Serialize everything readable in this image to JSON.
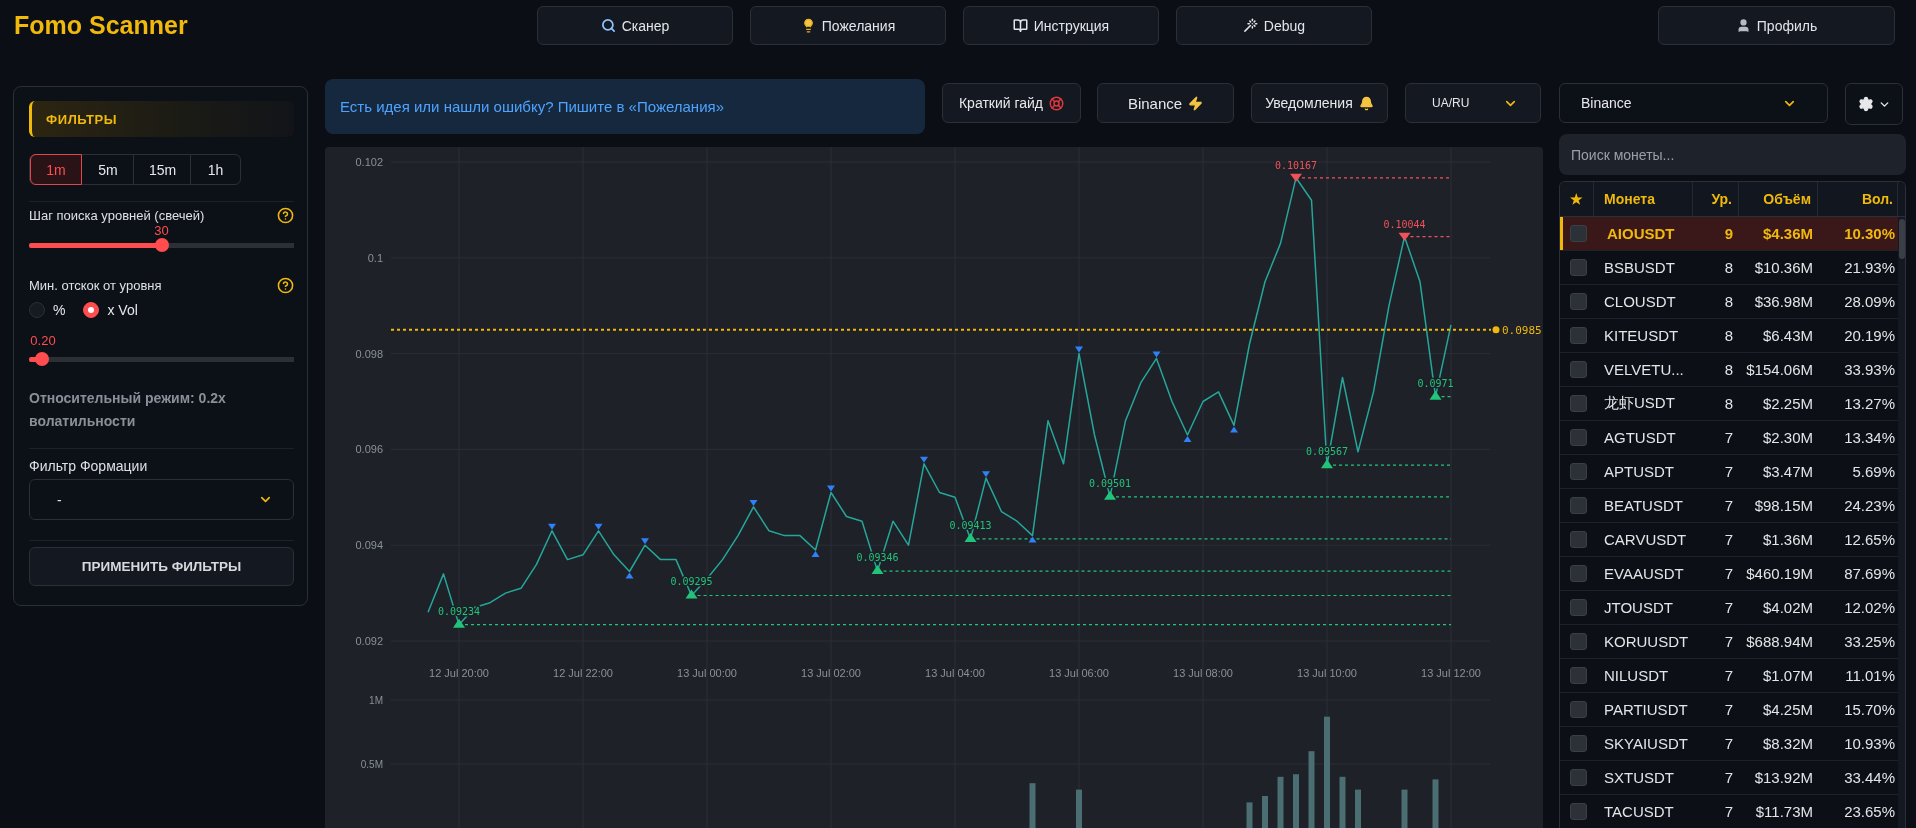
{
  "header": {
    "logo": "Fomo Scanner",
    "nav": [
      "Сканер",
      "Пожелания",
      "Инструкция",
      "Debug"
    ],
    "profile": "Профиль"
  },
  "filters": {
    "title": "ФИЛЬТРЫ",
    "timeframes": [
      {
        "label": "1m",
        "selected": true
      },
      {
        "label": "5m",
        "selected": false
      },
      {
        "label": "15m",
        "selected": false
      },
      {
        "label": "1h",
        "selected": false
      }
    ],
    "level_step": {
      "label": "Шаг поиска уровней (свечей)",
      "reading": "30",
      "level": 0.5
    },
    "min_bounce": {
      "label": "Мин. отскок от уровня",
      "modes": [
        {
          "label": "%",
          "selected": false
        },
        {
          "label": "x Vol",
          "selected": true
        }
      ],
      "reading": "0.20",
      "level": 0.05
    },
    "mode_note": "Относительный режим: 0.2x волатильности",
    "formation": {
      "label": "Фильтр Формации",
      "value": "-"
    },
    "apply_button": "ПРИМЕНИТЬ ФИЛЬТРЫ"
  },
  "banner": "Есть идея или нашли ошибку? Пишите в «Пожелания»",
  "toolbar": {
    "buttons": [
      "Краткий гайд",
      "Binance",
      "Уведомления"
    ],
    "language": "UA/RU"
  },
  "exchange_select": {
    "value": "Binance"
  },
  "chart": {
    "chart_data": {
      "type": "line",
      "grid": true,
      "categories": [
        null,
        null,
        "12 Jul 20:00",
        null,
        null,
        null,
        null,
        null,
        null,
        null,
        "12 Jul 22:00",
        null,
        null,
        null,
        null,
        null,
        null,
        null,
        "13 Jul 00:00",
        null,
        null,
        null,
        null,
        null,
        null,
        null,
        "13 Jul 02:00",
        null,
        null,
        null,
        null,
        null,
        null,
        null,
        "13 Jul 04:00",
        null,
        null,
        null,
        null,
        null,
        null,
        null,
        "13 Jul 06:00",
        null,
        null,
        null,
        null,
        null,
        null,
        null,
        "13 Jul 08:00",
        null,
        null,
        null,
        null,
        null,
        null,
        null,
        "13 Jul 10:00",
        null,
        null,
        null,
        null,
        null,
        null,
        null,
        "13 Jul 12:00"
      ],
      "series": [
        {
          "color": "#26a69a",
          "values": [
            0.0926,
            0.0934,
            0.09234,
            0.0927,
            0.0928,
            0.093,
            0.0931,
            0.0936,
            0.0943,
            0.0937,
            0.0938,
            0.0943,
            0.0938,
            0.09345,
            0.094,
            0.0937,
            0.0937,
            0.09295,
            0.0933,
            0.0937,
            0.0942,
            0.0948,
            0.0943,
            0.0942,
            0.0942,
            0.0939,
            0.0951,
            0.0946,
            0.0945,
            0.09346,
            0.0945,
            0.094,
            0.0957,
            0.0951,
            0.095,
            0.09413,
            0.0954,
            0.0947,
            0.0945,
            0.0942,
            0.0966,
            0.0957,
            0.098,
            0.0963,
            0.09501,
            0.0966,
            0.0974,
            0.0979,
            0.097,
            0.0963,
            0.097,
            0.0972,
            0.0965,
            0.0982,
            0.0995,
            0.1003,
            0.10167,
            0.1012,
            0.09567,
            0.0975,
            0.09595,
            0.0972,
            0.099,
            0.10044,
            0.0995,
            0.0971,
            0.0986
          ]
        }
      ],
      "ylim": [
        0.092,
        0.102
      ],
      "yticks": [
        0.092,
        0.094,
        0.096,
        0.098,
        0.1,
        0.102
      ],
      "annotations": [
        {
          "y": 0.09234,
          "text": "0.09234"
        },
        {
          "y": 0.09295,
          "text": "0.09295"
        },
        {
          "y": 0.09346,
          "text": "0.09346"
        },
        {
          "y": 0.09413,
          "text": "0.09413"
        },
        {
          "y": 0.09501,
          "text": "0.09501"
        },
        {
          "y": 0.10167,
          "text": "0.10167"
        },
        {
          "y": 0.09567,
          "text": "0.09567"
        },
        {
          "y": 0.10044,
          "text": "0.10044"
        },
        {
          "y": 0.0971,
          "text": "0.0971"
        }
      ],
      "ref_lines": [
        {
          "axis": "y",
          "value": 0.09234
        },
        {
          "axis": "y",
          "value": 0.09295
        },
        {
          "axis": "y",
          "value": 0.09346
        },
        {
          "axis": "y",
          "value": 0.09413
        },
        {
          "axis": "y",
          "value": 0.09501
        },
        {
          "axis": "y",
          "value": 0.10167
        },
        {
          "axis": "y",
          "value": 0.09567
        },
        {
          "axis": "y",
          "value": 0.0985,
          "label": "0.0985"
        }
      ]
    }
  },
  "volume_chart": {
    "chart_data": {
      "type": "bar",
      "grid": true,
      "categories": [
        null,
        null,
        null,
        null,
        null,
        null,
        null,
        null,
        null,
        null,
        null,
        null,
        null,
        null,
        null,
        null,
        null,
        null,
        null,
        null,
        null,
        null,
        null,
        null,
        null,
        null,
        null,
        null,
        null,
        null,
        null,
        null,
        null,
        null,
        null,
        null,
        null,
        null,
        null,
        null,
        null,
        null,
        null,
        null,
        null,
        null,
        null,
        null,
        null,
        null,
        null,
        null,
        null,
        null,
        null,
        null,
        null,
        null,
        null,
        null,
        null,
        null,
        null,
        null,
        null,
        null,
        null
      ],
      "values": [
        null,
        null,
        null,
        null,
        null,
        null,
        null,
        null,
        null,
        null,
        null,
        null,
        null,
        null,
        null,
        null,
        null,
        null,
        null,
        null,
        null,
        null,
        null,
        null,
        null,
        null,
        null,
        null,
        null,
        null,
        null,
        null,
        null,
        null,
        null,
        null,
        null,
        null,
        null,
        0.35,
        null,
        null,
        0.3,
        null,
        null,
        null,
        null,
        null,
        null,
        null,
        null,
        null,
        null,
        0.2,
        0.25,
        0.4,
        0.42,
        0.6,
        0.87,
        0.4,
        0.3,
        null,
        null,
        0.3,
        null,
        0.38,
        null
      ],
      "ylim": [
        0,
        1
      ],
      "yticks": [
        {
          "value": 1,
          "label": "1M"
        },
        {
          "value": 0.5,
          "label": "0.5M"
        }
      ]
    }
  },
  "coin_search": {
    "placeholder": "Поиск монеты..."
  },
  "table": {
    "columns": [
      "★",
      "Монета",
      "Ур.",
      "Объём",
      "Вол."
    ],
    "rows": [
      {
        "selected": true,
        "checked": false,
        "coin": "AIOUSDT",
        "levels": "9",
        "volume": "$4.36M",
        "vol": "10.30%"
      },
      {
        "selected": false,
        "checked": false,
        "coin": "BSBUSDT",
        "levels": "8",
        "volume": "$10.36M",
        "vol": "21.93%"
      },
      {
        "selected": false,
        "checked": false,
        "coin": "CLOUSDT",
        "levels": "8",
        "volume": "$36.98M",
        "vol": "28.09%"
      },
      {
        "selected": false,
        "checked": false,
        "coin": "KITEUSDT",
        "levels": "8",
        "volume": "$6.43M",
        "vol": "20.19%"
      },
      {
        "selected": false,
        "checked": false,
        "coin": "VELVETU...",
        "levels": "8",
        "volume": "$154.06M",
        "vol": "33.93%"
      },
      {
        "selected": false,
        "checked": false,
        "coin": "龙虾USDT",
        "levels": "8",
        "volume": "$2.25M",
        "vol": "13.27%"
      },
      {
        "selected": false,
        "checked": false,
        "coin": "AGTUSDT",
        "levels": "7",
        "volume": "$2.30M",
        "vol": "13.34%"
      },
      {
        "selected": false,
        "checked": false,
        "coin": "APTUSDT",
        "levels": "7",
        "volume": "$3.47M",
        "vol": "5.69%"
      },
      {
        "selected": false,
        "checked": false,
        "coin": "BEATUSDT",
        "levels": "7",
        "volume": "$98.15M",
        "vol": "24.23%"
      },
      {
        "selected": false,
        "checked": false,
        "coin": "CARVUSDT",
        "levels": "7",
        "volume": "$1.36M",
        "vol": "12.65%"
      },
      {
        "selected": false,
        "checked": false,
        "coin": "EVAAUSDT",
        "levels": "7",
        "volume": "$460.19M",
        "vol": "87.69%"
      },
      {
        "selected": false,
        "checked": false,
        "coin": "JTOUSDT",
        "levels": "7",
        "volume": "$4.02M",
        "vol": "12.02%"
      },
      {
        "selected": false,
        "checked": false,
        "coin": "KORUUSDT",
        "levels": "7",
        "volume": "$688.94M",
        "vol": "33.25%"
      },
      {
        "selected": false,
        "checked": false,
        "coin": "NILUSDT",
        "levels": "7",
        "volume": "$1.07M",
        "vol": "11.01%"
      },
      {
        "selected": false,
        "checked": false,
        "coin": "PARTIUSDT",
        "levels": "7",
        "volume": "$4.25M",
        "vol": "15.70%"
      },
      {
        "selected": false,
        "checked": false,
        "coin": "SKYAIUSDT",
        "levels": "7",
        "volume": "$8.32M",
        "vol": "10.93%"
      },
      {
        "selected": false,
        "checked": false,
        "coin": "SXTUSDT",
        "levels": "7",
        "volume": "$13.92M",
        "vol": "33.44%"
      },
      {
        "selected": false,
        "checked": false,
        "coin": "TACUSDT",
        "levels": "7",
        "volume": "$11.73M",
        "vol": "23.65%"
      }
    ]
  }
}
